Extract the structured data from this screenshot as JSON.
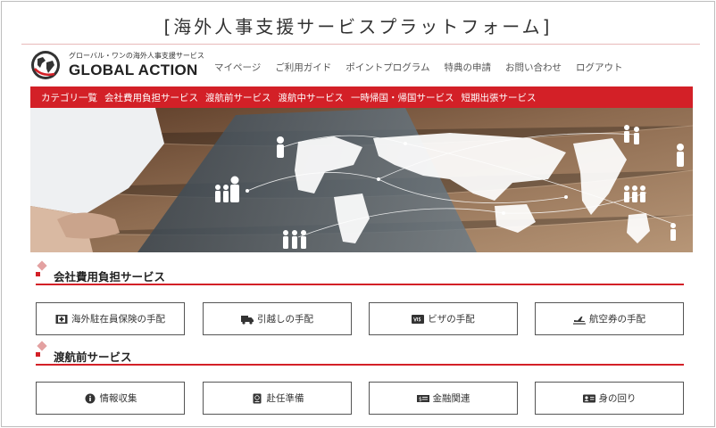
{
  "page": {
    "title": "[海外人事支援サービスプラットフォーム]"
  },
  "logo": {
    "tagline": "グローバル・ワンの海外人事支援サービス",
    "brand": "GLOBAL ACTION"
  },
  "main_nav": [
    "マイページ",
    "ご利用ガイド",
    "ポイントプログラム",
    "特典の申請",
    "お問い合わせ",
    "ログアウト"
  ],
  "category_nav": [
    "カテゴリ一覧",
    "会社費用負担サービス",
    "渡航前サービス",
    "渡航中サービス",
    "一時帰国・帰国サービス",
    "短期出張サービス"
  ],
  "sections": [
    {
      "title": "会社費用負担サービス",
      "buttons": [
        {
          "label": "海外駐在員保険の手配",
          "icon": "insurance-icon"
        },
        {
          "label": "引越しの手配",
          "icon": "truck-icon"
        },
        {
          "label": "ビザの手配",
          "icon": "visa-icon"
        },
        {
          "label": "航空券の手配",
          "icon": "plane-icon"
        }
      ]
    },
    {
      "title": "渡航前サービス",
      "buttons": [
        {
          "label": "情報収集",
          "icon": "info-icon"
        },
        {
          "label": "赴任準備",
          "icon": "passport-icon"
        },
        {
          "label": "金融関連",
          "icon": "money-icon"
        },
        {
          "label": "身の回り",
          "icon": "id-card-icon"
        }
      ]
    }
  ],
  "colors": {
    "accent": "#d32027",
    "text": "#333333"
  }
}
